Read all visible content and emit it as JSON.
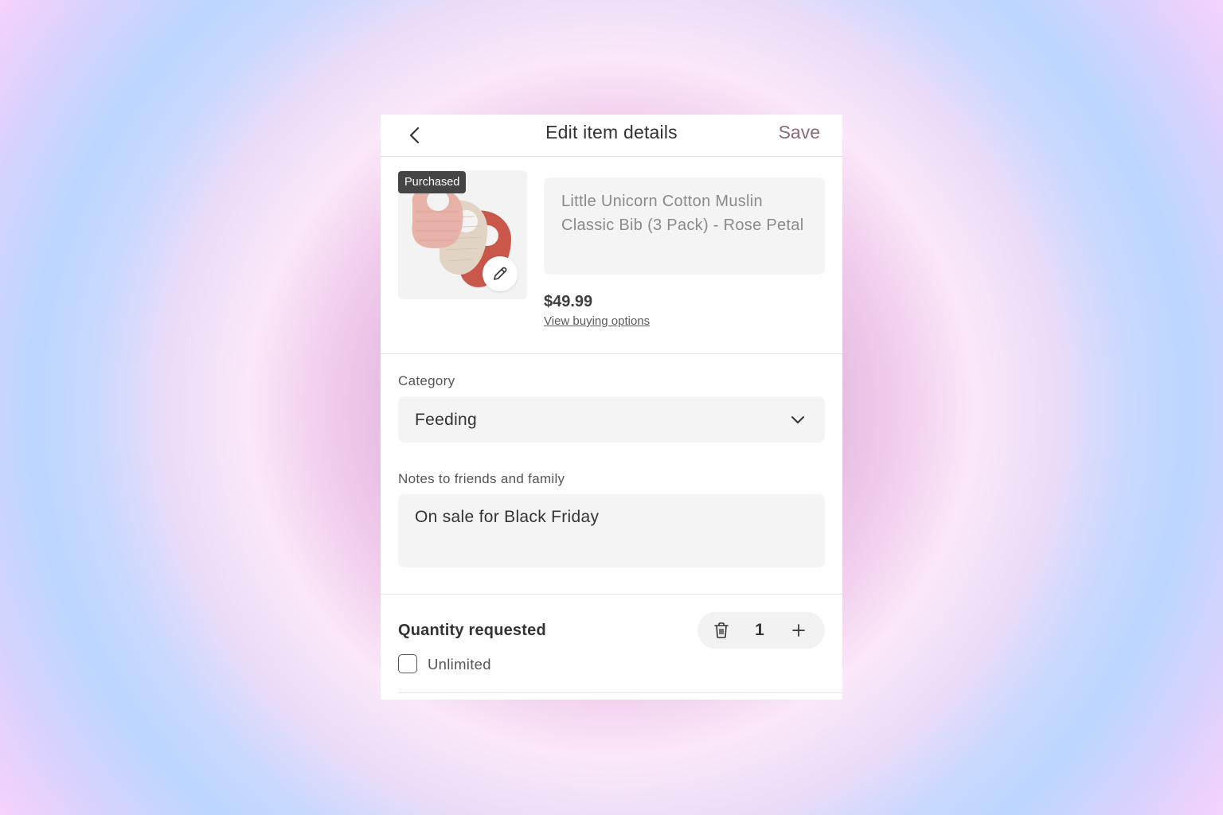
{
  "header": {
    "title": "Edit item details",
    "save_label": "Save",
    "back_icon": "chevron-left-icon"
  },
  "product": {
    "badge": "Purchased",
    "name": "Little Unicorn Cotton Muslin Classic Bib (3 Pack) - Rose Petal",
    "price": "$49.99",
    "buying_link": "View buying options",
    "edit_icon": "pencil-icon"
  },
  "category": {
    "label": "Category",
    "value": "Feeding",
    "chevron_icon": "chevron-down-icon"
  },
  "notes": {
    "label": "Notes to friends and family",
    "value": "On sale for Black Friday"
  },
  "quantity": {
    "label": "Quantity requested",
    "value": "1",
    "trash_icon": "trash-icon",
    "plus_icon": "plus-icon",
    "unlimited_label": "Unlimited",
    "unlimited_checked": false
  },
  "colors": {
    "save": "#8a6a7c",
    "field_bg": "#f4f4f4",
    "badge_bg": "#454545",
    "bib_pink": "#e7b3a8",
    "bib_beige": "#e2d4c4",
    "bib_red": "#c9574a"
  }
}
